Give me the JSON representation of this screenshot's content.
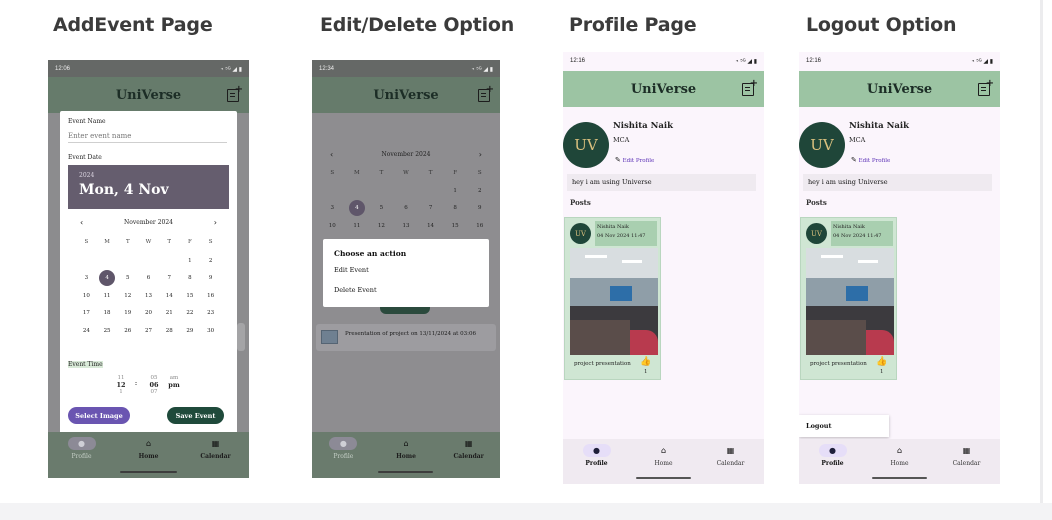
{
  "captions": [
    "AddEvent Page",
    "Edit/Delete Option",
    "Profile Page",
    "Logout Option"
  ],
  "app": {
    "name": "UniVerse"
  },
  "phone1": {
    "time": "12:06",
    "status_icons": "◔ ⁵ᴳ ◢ ▮",
    "event_name_label": "Event Name",
    "event_name_placeholder": "Enter event name",
    "event_date_label": "Event Date",
    "year": "2024",
    "date_big": "Mon, 4 Nov",
    "month_label": "November 2024",
    "weekdays": [
      "S",
      "M",
      "T",
      "W",
      "T",
      "F",
      "S"
    ],
    "days": [
      "",
      "",
      "",
      "",
      "",
      "1",
      "2",
      "3",
      "4",
      "5",
      "6",
      "7",
      "8",
      "9",
      "10",
      "11",
      "12",
      "13",
      "14",
      "15",
      "16",
      "17",
      "18",
      "19",
      "20",
      "21",
      "22",
      "23",
      "24",
      "25",
      "26",
      "27",
      "28",
      "29",
      "30"
    ],
    "selected_day": "4",
    "event_time_label": "Event Time",
    "time_hour_prev": "11",
    "time_hour": "12",
    "time_hour_next": "1",
    "time_min_prev": "05",
    "time_min": "06",
    "time_min_next": "07",
    "time_ampm_prev": "am",
    "time_ampm": "pm",
    "colon": ":",
    "select_image": "Select Image",
    "save_event": "Save Event"
  },
  "phone2": {
    "time": "12:34",
    "status_icons": "◔ ⁵ᴳ ◢ ▮",
    "month_label": "November 2024",
    "weekdays": [
      "S",
      "M",
      "T",
      "W",
      "T",
      "F",
      "S"
    ],
    "days": [
      "",
      "",
      "",
      "",
      "",
      "1",
      "2",
      "3",
      "4",
      "5",
      "6",
      "7",
      "8",
      "9",
      "10",
      "11",
      "12",
      "13",
      "14",
      "15",
      "16"
    ],
    "selected_day": "4",
    "dialog_title": "Choose an action",
    "edit_event": "Edit Event",
    "delete_event": "Delete Event",
    "event_item": "Presentation of project  on 13/11/2024 at 03:06"
  },
  "nav": {
    "profile": "Profile",
    "home": "Home",
    "calendar": "Calendar"
  },
  "profile": {
    "time": "12:16",
    "status_icons": "◔ ⁵ᴳ ◢ ▮",
    "name": "Nishita Naik",
    "course": "MCA",
    "edit_profile": "Edit Profile",
    "bio": "hey i am using Universe",
    "posts_label": "Posts",
    "post_author": "Nishita Naik",
    "post_date": "04 Nov 2024 11:47",
    "post_caption": "project presentation",
    "likes": "1",
    "avatar_text": "UV"
  },
  "logout": {
    "label": "Logout"
  },
  "colors": {
    "appbar_green": "#9cc4a3",
    "appbar_dim": "#687d6c",
    "selected_purple": "#5f566a",
    "select_image_btn": "#6a55b1",
    "save_event_btn": "#1f4a3b",
    "profile_bg": "#fbf5fc"
  }
}
